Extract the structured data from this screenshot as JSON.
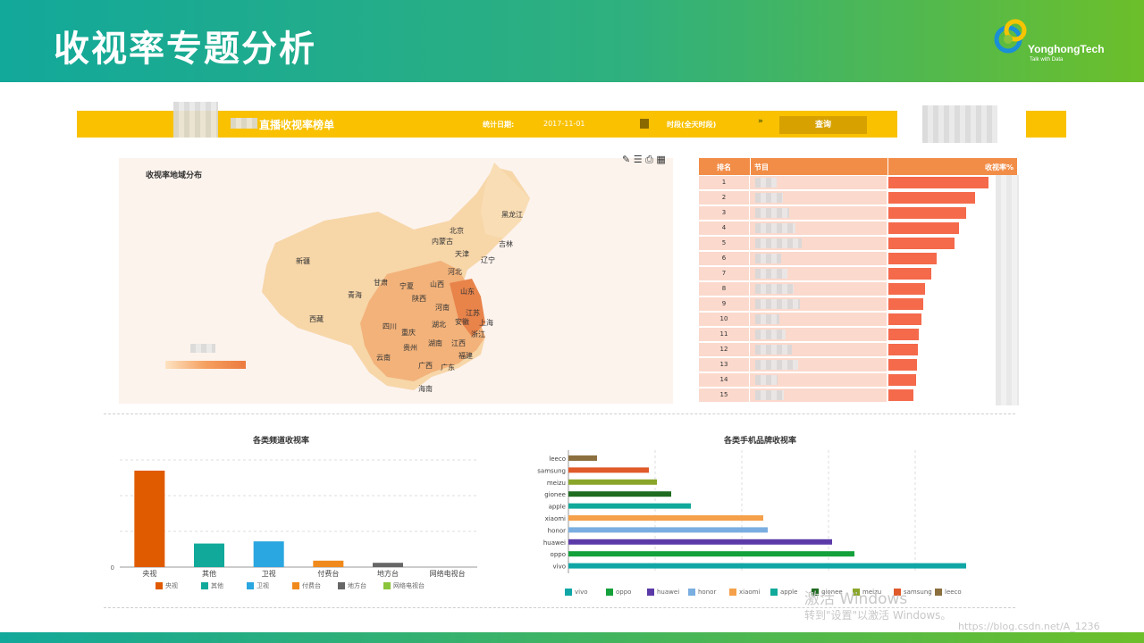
{
  "header": {
    "title": "收视率专题分析",
    "logo_brand": "YonghongTech",
    "logo_tagline": "Talk with Data"
  },
  "toolbar": {
    "title": "直播收视率榜单",
    "date_label": "统计日期:",
    "date_value": "2017-11-01",
    "period_label": "时段(全天时段)",
    "query_label": "查询"
  },
  "map": {
    "title": "收视率地域分布",
    "provinces": [
      "黑龙江",
      "吉林",
      "辽宁",
      "北京",
      "内蒙古",
      "天津",
      "河北",
      "新疆",
      "甘肃",
      "宁夏",
      "山西",
      "山东",
      "青海",
      "陕西",
      "河南",
      "江苏",
      "上海",
      "西藏",
      "四川",
      "重庆",
      "湖北",
      "安徽",
      "浙江",
      "贵州",
      "湖南",
      "江西",
      "云南",
      "广西",
      "广东",
      "福建",
      "海南"
    ]
  },
  "ranking": {
    "headers": [
      "排名",
      "节目",
      "收视率%"
    ],
    "ranks": [
      "1",
      "2",
      "3",
      "4",
      "5",
      "6",
      "7",
      "8",
      "9",
      "10",
      "11",
      "12",
      "13",
      "14",
      "15"
    ],
    "values": [
      0.95,
      0.82,
      0.74,
      0.67,
      0.63,
      0.46,
      0.41,
      0.35,
      0.33,
      0.31,
      0.29,
      0.28,
      0.27,
      0.26,
      0.24
    ]
  },
  "channel_chart": {
    "title": "各类频道收视率",
    "chart_data": {
      "type": "bar",
      "categories": [
        "央视",
        "其他",
        "卫视",
        "付费台",
        "地方台",
        "网络电视台"
      ],
      "values": [
        4.5,
        1.1,
        1.2,
        0.3,
        0.2,
        0.0
      ],
      "ytick_zero": "0",
      "colors": [
        "#e05a00",
        "#10a99a",
        "#2aa6e0",
        "#f08a1c",
        "#666666",
        "#8ac43a"
      ]
    },
    "legend": [
      "央视",
      "其他",
      "卫视",
      "付费台",
      "地方台",
      "网络电视台"
    ]
  },
  "brand_chart": {
    "title": "各类手机品牌收视率",
    "chart_data": {
      "type": "bar",
      "categories": [
        "leeco",
        "samsung",
        "meizu",
        "gionee",
        "apple",
        "xiaomi",
        "honor",
        "huawei",
        "oppo",
        "vivo"
      ],
      "values": [
        0.32,
        0.9,
        0.99,
        1.15,
        1.37,
        2.18,
        2.23,
        2.95,
        3.2,
        4.45
      ],
      "colors": [
        "#8b6f3e",
        "#e05a2a",
        "#8aa62a",
        "#1f6b20",
        "#10a99a",
        "#f5a04a",
        "#7aaee0",
        "#5b3aa8",
        "#14a03a",
        "#10a6a6"
      ]
    },
    "legend": [
      "vivo",
      "oppo",
      "huawei",
      "honor",
      "xiaomi",
      "apple",
      "gionee",
      "meizu",
      "samsung",
      "leeco"
    ],
    "legend_colors": [
      "#10a6a6",
      "#14a03a",
      "#5b3aa8",
      "#7aaee0",
      "#f5a04a",
      "#10a99a",
      "#1f6b20",
      "#8aa62a",
      "#e05a2a",
      "#8b6f3e"
    ]
  },
  "watermark": {
    "activate_line1": "激活 Windows",
    "activate_line2": "转到\"设置\"以激活 Windows。",
    "url": "https://blog.csdn.net/A_1236"
  }
}
